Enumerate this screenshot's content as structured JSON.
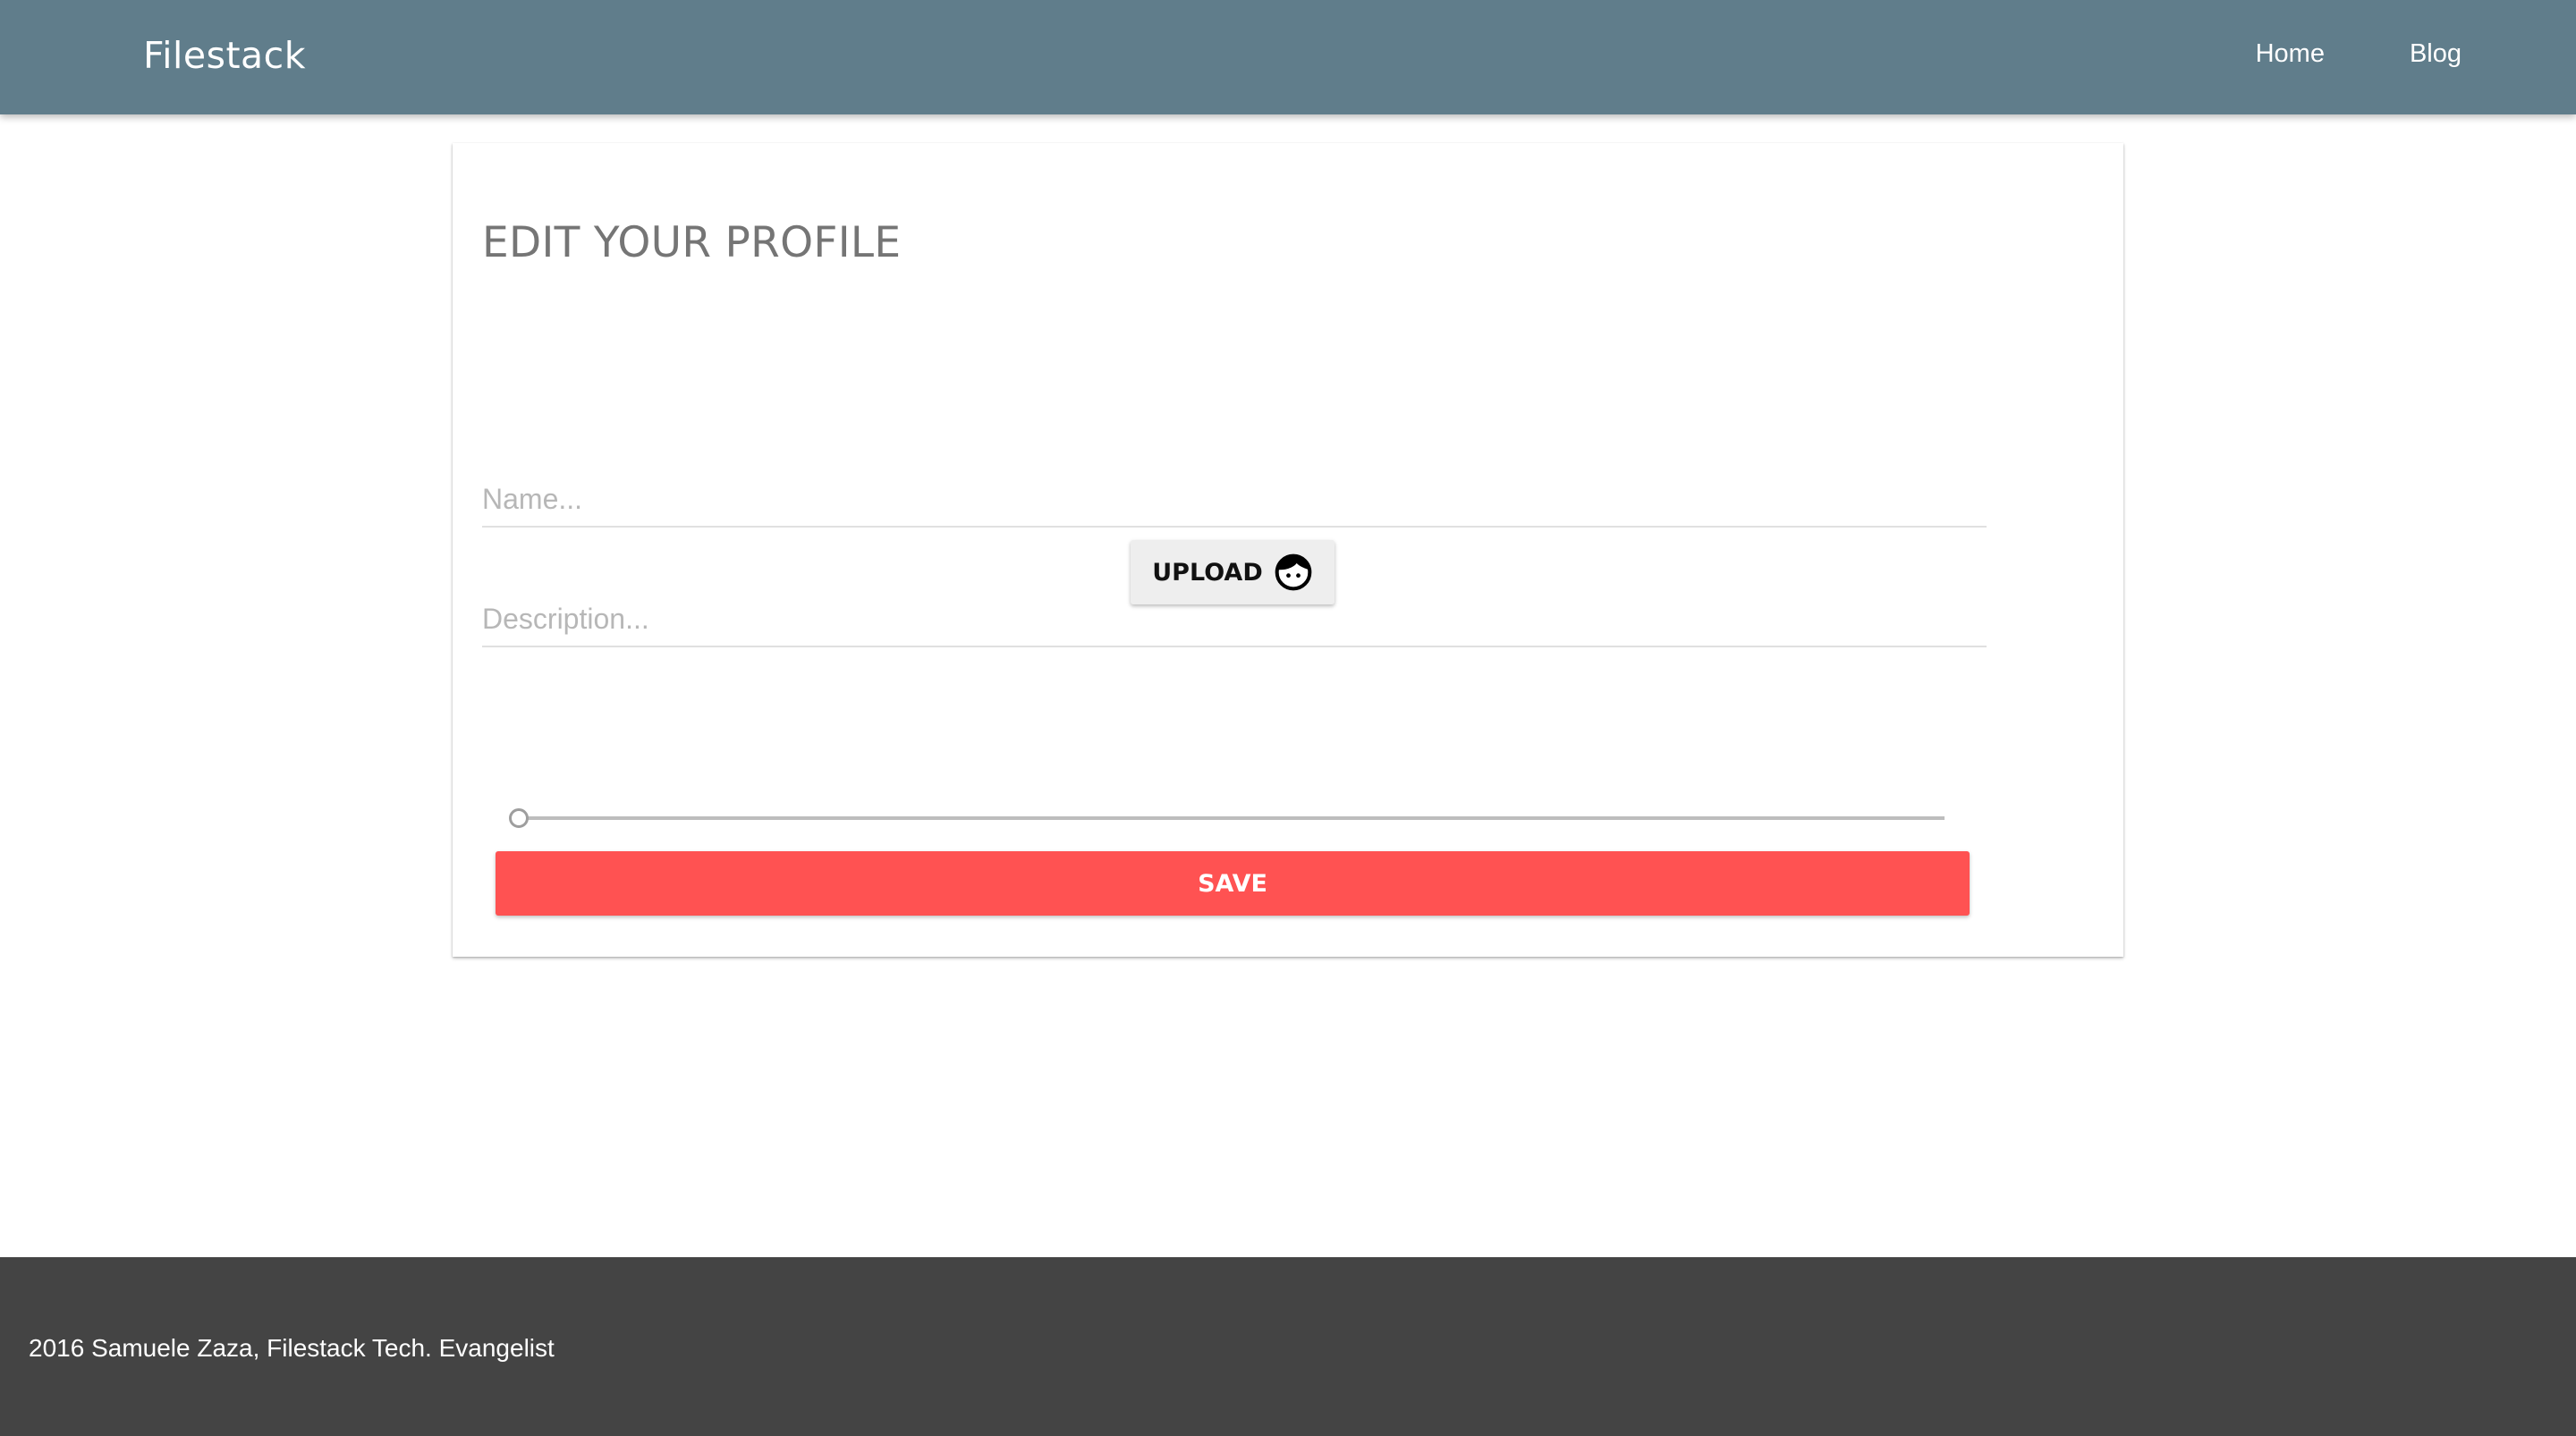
{
  "navbar": {
    "brand": "Filestack",
    "links": [
      {
        "label": "Home"
      },
      {
        "label": "Blog"
      }
    ],
    "background_color": "#607d8b"
  },
  "profile_form": {
    "title": "EDIT YOUR PROFILE",
    "name_input": {
      "placeholder": "Name...",
      "value": ""
    },
    "description_input": {
      "placeholder": "Description...",
      "value": ""
    },
    "upload_button": {
      "label": "UPLOAD",
      "icon": "face-icon"
    },
    "slider": {
      "value": 0
    },
    "save_button": {
      "label": "SAVE",
      "color": "#ff5252"
    }
  },
  "footer": {
    "text": "2016 Samuele Zaza, Filestack Tech. Evangelist",
    "background_color": "#444444"
  }
}
